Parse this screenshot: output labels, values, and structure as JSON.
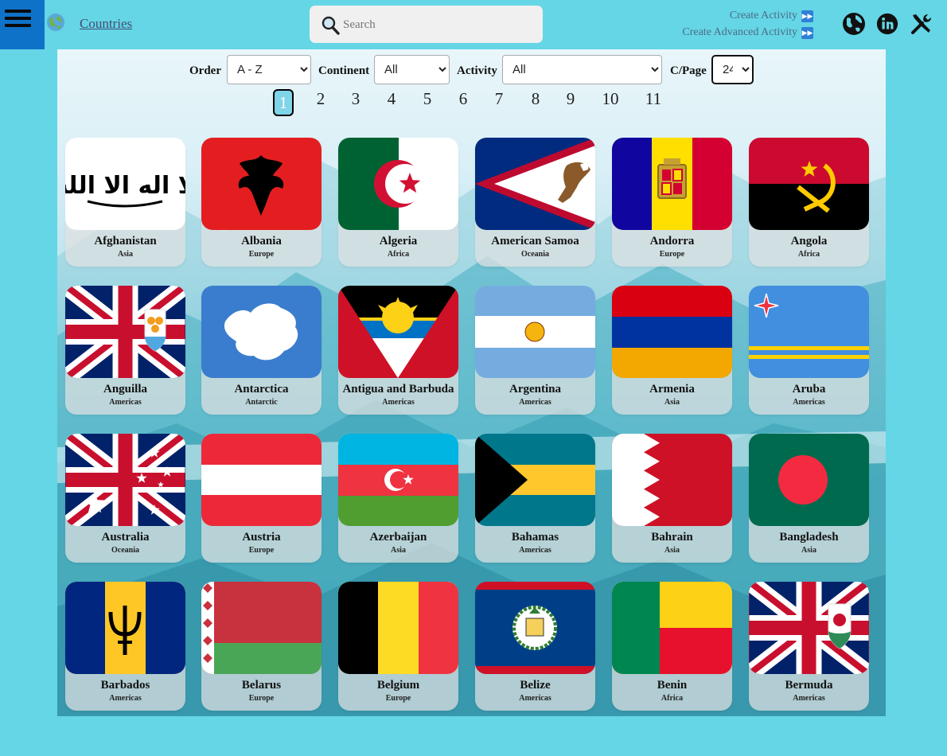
{
  "header": {
    "nav_label": "Countries",
    "search_placeholder": "Search",
    "create_activity": "Create Activity",
    "create_advanced_activity": "Create Advanced Activity"
  },
  "filters": {
    "order_label": "Order",
    "order_value": "A - Z",
    "continent_label": "Continent",
    "continent_value": "All",
    "activity_label": "Activity",
    "activity_value": "All",
    "cpage_label": "C/Page",
    "cpage_value": "24"
  },
  "pagination": {
    "pages": [
      "1",
      "2",
      "3",
      "4",
      "5",
      "6",
      "7",
      "8",
      "9",
      "10",
      "11"
    ],
    "current": "1"
  },
  "countries": [
    {
      "name": "Afghanistan",
      "continent": "Asia",
      "flag": "afghanistan"
    },
    {
      "name": "Albania",
      "continent": "Europe",
      "flag": "albania"
    },
    {
      "name": "Algeria",
      "continent": "Africa",
      "flag": "algeria"
    },
    {
      "name": "American Samoa",
      "continent": "Oceania",
      "flag": "american-samoa"
    },
    {
      "name": "Andorra",
      "continent": "Europe",
      "flag": "andorra"
    },
    {
      "name": "Angola",
      "continent": "Africa",
      "flag": "angola"
    },
    {
      "name": "Anguilla",
      "continent": "Americas",
      "flag": "anguilla"
    },
    {
      "name": "Antarctica",
      "continent": "Antarctic",
      "flag": "antarctica"
    },
    {
      "name": "Antigua and Barbuda",
      "continent": "Americas",
      "flag": "antigua-and-barbuda"
    },
    {
      "name": "Argentina",
      "continent": "Americas",
      "flag": "argentina"
    },
    {
      "name": "Armenia",
      "continent": "Asia",
      "flag": "armenia"
    },
    {
      "name": "Aruba",
      "continent": "Americas",
      "flag": "aruba"
    },
    {
      "name": "Australia",
      "continent": "Oceania",
      "flag": "australia"
    },
    {
      "name": "Austria",
      "continent": "Europe",
      "flag": "austria"
    },
    {
      "name": "Azerbaijan",
      "continent": "Asia",
      "flag": "azerbaijan"
    },
    {
      "name": "Bahamas",
      "continent": "Americas",
      "flag": "bahamas"
    },
    {
      "name": "Bahrain",
      "continent": "Asia",
      "flag": "bahrain"
    },
    {
      "name": "Bangladesh",
      "continent": "Asia",
      "flag": "bangladesh"
    },
    {
      "name": "Barbados",
      "continent": "Americas",
      "flag": "barbados"
    },
    {
      "name": "Belarus",
      "continent": "Europe",
      "flag": "belarus"
    },
    {
      "name": "Belgium",
      "continent": "Europe",
      "flag": "belgium"
    },
    {
      "name": "Belize",
      "continent": "Americas",
      "flag": "belize"
    },
    {
      "name": "Benin",
      "continent": "Africa",
      "flag": "benin"
    },
    {
      "name": "Bermuda",
      "continent": "Americas",
      "flag": "bermuda"
    }
  ]
}
